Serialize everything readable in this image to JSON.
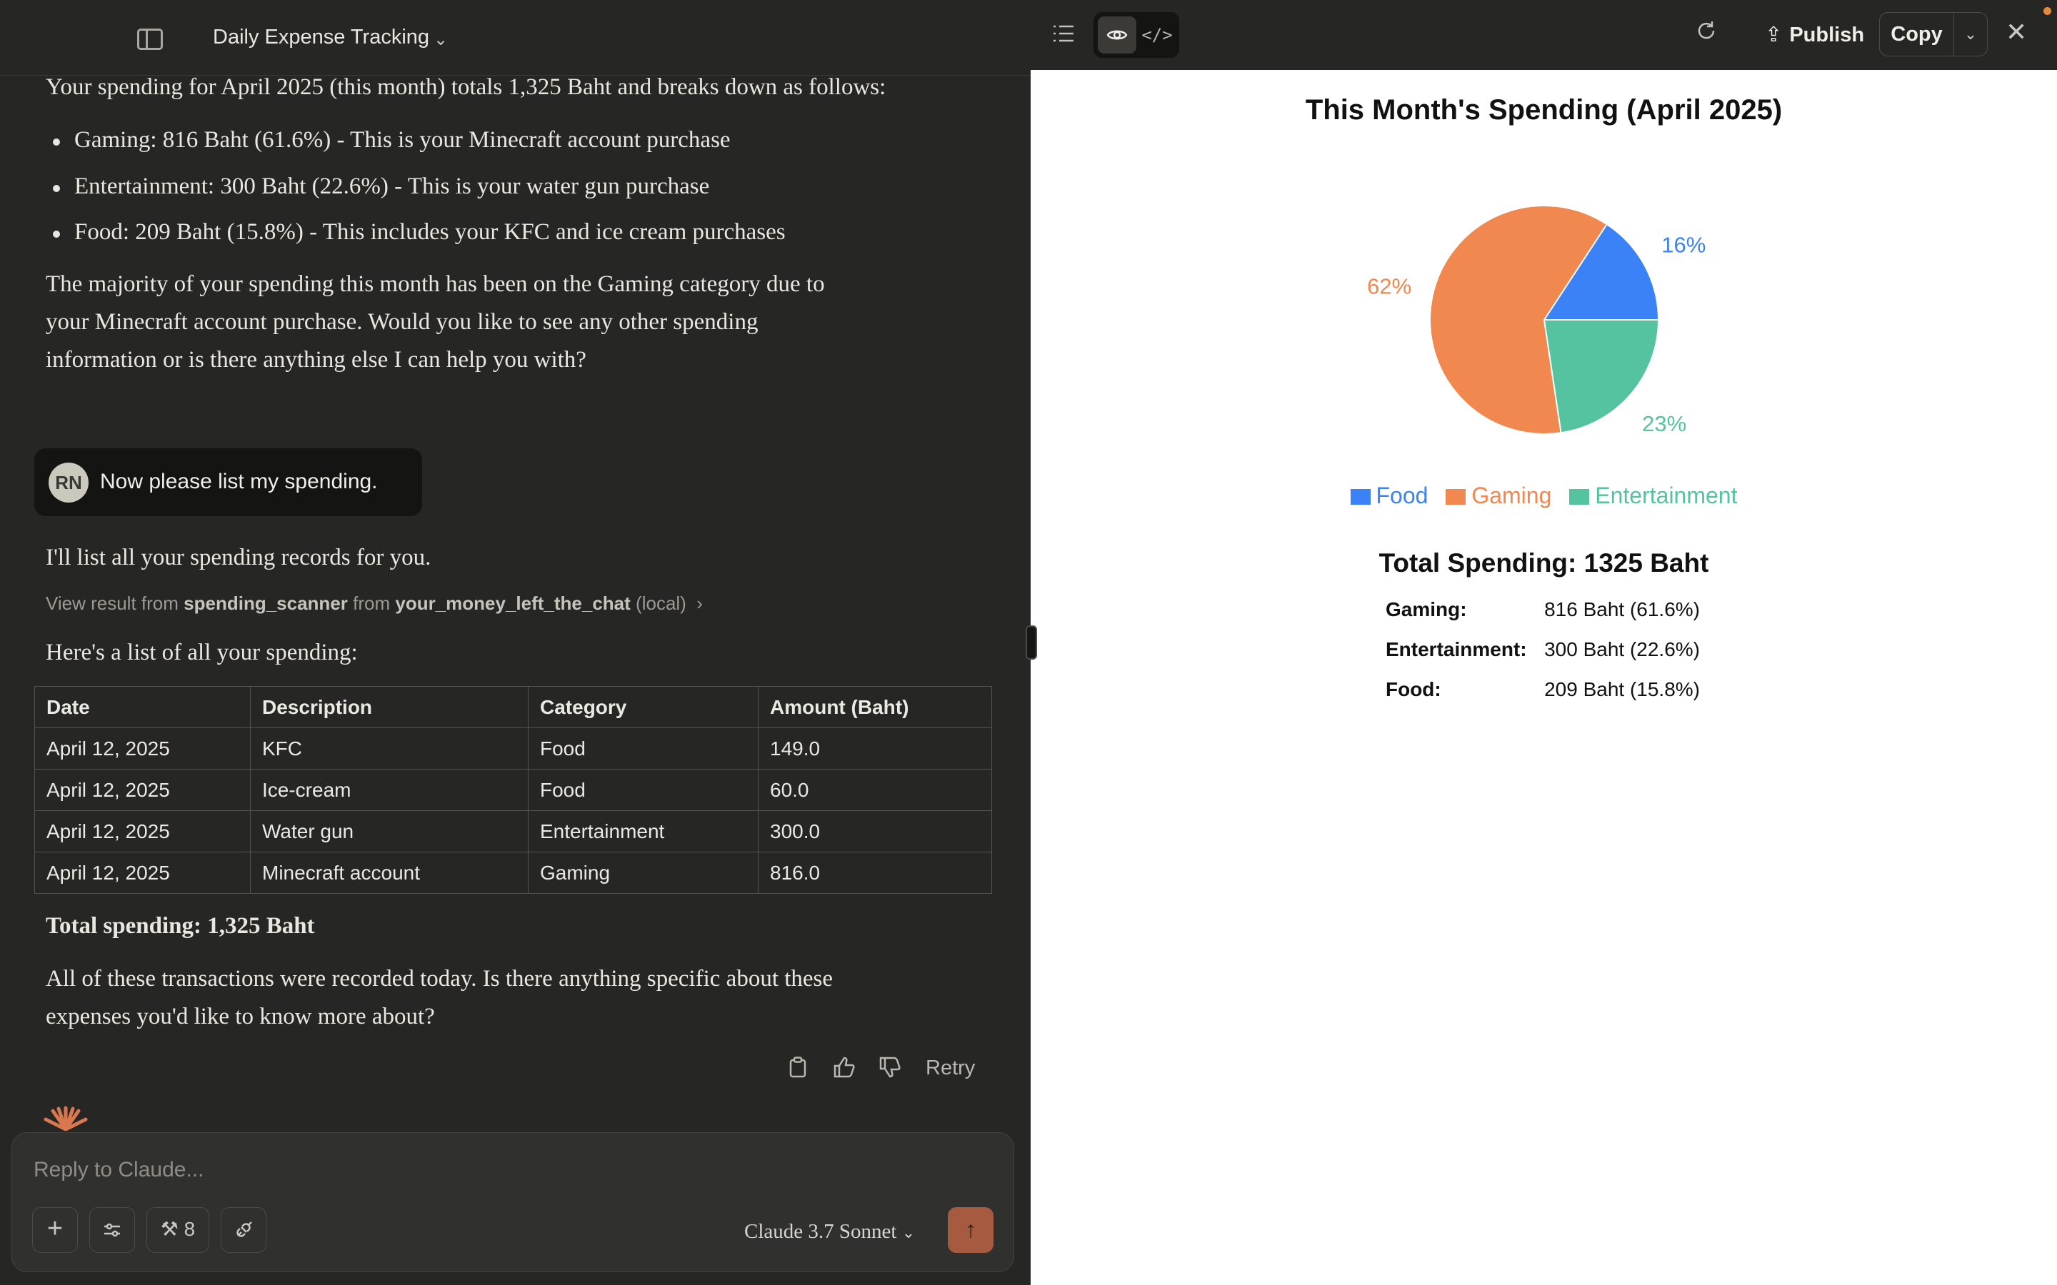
{
  "chat": {
    "title": "Daily Expense Tracking",
    "assistant_intro": "Your spending for April 2025 (this month) totals 1,325 Baht and breaks down as follows:",
    "bullets": [
      "Gaming: 816 Baht (61.6%) - This is your Minecraft account purchase",
      "Entertainment: 300 Baht (22.6%) - This is your water gun purchase",
      "Food: 209 Baht (15.8%) - This includes your KFC and ice cream purchases"
    ],
    "majority_line1": "The majority of your spending this month has been on the Gaming category due to",
    "majority_line2": "your Minecraft account purchase. Would you like to see any other spending",
    "majority_line3": "information or is there anything else I can help you with?",
    "user": {
      "initials": "RN",
      "message": "Now please list my spending."
    },
    "list_intro": "I'll list all your spending records for you.",
    "tool_prefix": "View result from",
    "tool_name": "spending_scanner",
    "tool_from": "from",
    "tool_source": "your_money_left_the_chat",
    "tool_local": "(local)",
    "list_heading": "Here's a list of all your spending:",
    "table": {
      "headers": [
        "Date",
        "Description",
        "Category",
        "Amount (Baht)"
      ],
      "rows": [
        [
          "April 12, 2025",
          "KFC",
          "Food",
          "149.0"
        ],
        [
          "April 12, 2025",
          "Ice-cream",
          "Food",
          "60.0"
        ],
        [
          "April 12, 2025",
          "Water gun",
          "Entertainment",
          "300.0"
        ],
        [
          "April 12, 2025",
          "Minecraft account",
          "Gaming",
          "816.0"
        ]
      ]
    },
    "total_line": "Total spending: 1,325 Baht",
    "closing_line1": "All of these transactions were recorded today. Is there anything specific about these",
    "closing_line2": "expenses you'd like to know more about?",
    "actions": {
      "retry": "Retry"
    }
  },
  "composer": {
    "placeholder": "Reply to Claude...",
    "tools_count": "8",
    "model": "Claude 3.7 Sonnet"
  },
  "artifact_toolbar": {
    "publish_label": "Publish",
    "copy_label": "Copy"
  },
  "artifact": {
    "summary_title": "Total Spending: 1325 Baht",
    "summary": [
      {
        "label": "Gaming:",
        "value": "816 Baht (61.6%)"
      },
      {
        "label": "Entertainment:",
        "value": "300 Baht (22.6%)"
      },
      {
        "label": "Food:",
        "value": "209 Baht (15.8%)"
      }
    ]
  },
  "chart_data": {
    "type": "pie",
    "title": "This Month's Spending (April 2025)",
    "categories": [
      "Food",
      "Gaming",
      "Entertainment"
    ],
    "values": [
      209,
      816,
      300
    ],
    "percent_labels": [
      "16%",
      "62%",
      "23%"
    ],
    "colors": [
      "#3b82f6",
      "#f0884f",
      "#55c2a0"
    ],
    "legend_position": "bottom"
  }
}
